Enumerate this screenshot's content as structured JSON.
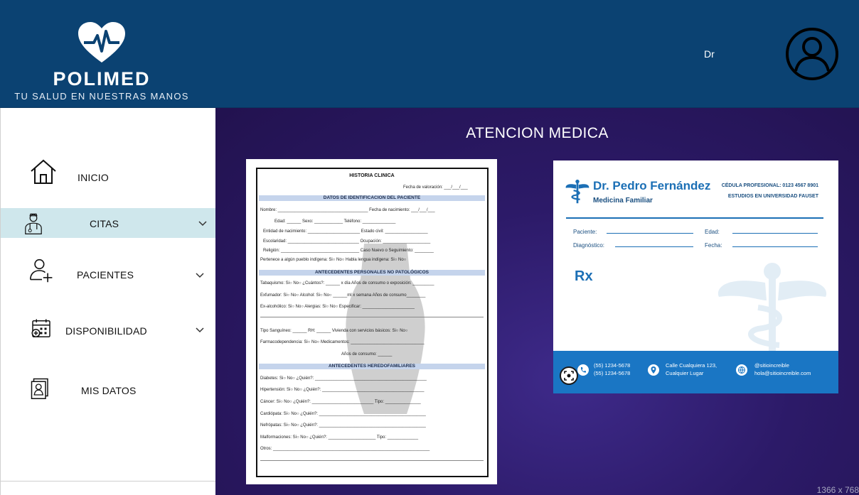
{
  "header": {
    "brand": "POLIMED",
    "tagline": "TU SALUD EN NUESTRAS MANOS",
    "user_label": "Dr"
  },
  "sidebar": {
    "items": [
      {
        "label": "INICIO",
        "icon": "home-icon"
      },
      {
        "label": "CITAS",
        "icon": "doctor-icon",
        "active": true,
        "expandable": true
      },
      {
        "label": "PACIENTES",
        "icon": "add-user-icon",
        "expandable": true
      },
      {
        "label": "DISPONIBILIDAD",
        "icon": "calendar-icon",
        "expandable": true
      },
      {
        "label": "MIS DATOS",
        "icon": "profile-document-icon"
      }
    ]
  },
  "main": {
    "title": "ATENCION MEDICA",
    "screen_size": "1366 x 768"
  },
  "historia_clinica": {
    "title": "HISTORIA CLINICA",
    "fecha_valoracion": "Fecha de valoración: ___/___/___",
    "section1": "DATOS DE IDENTIFICACION DEL PACIENTE",
    "section2": "ANTECEDENTES PERSONALES NO PATOLÓGICOS",
    "section3": "ANTECEDENTES HEREDOFAMILIARES",
    "rows1": [
      "Nombre: ______________________________________ Fecha de nacimiento: ___/___/___",
      "Edad: ______          Sexo: ____________          Teléfono: ______________",
      "Entidad de nacimiento: ______________________  Estado civil: __________________",
      "Escolaridad: ______________________________  Ocupación: ____________________",
      "Religión: _________________________________  Caso Nuevo o Seguimiento: ________",
      "Pertenece a algún pueblo indígena: Si○  No○     Habla lengua indígena: Si○  No○"
    ],
    "rows2": [
      "Tabaquismo: Si○  No○ ¿Cuántos?: ______ x día   Años de consumo o exposición: _________",
      "Exfumador: Si○ No○   Alcohol: Si○ No○ ______ml x semana   Años de consumo________",
      "Ex-alcohólico: Si○ No○   Alergias: Si○ No○ Especificar: ______________________",
      "Tipo Sanguíneo: ______   RH: ______   Vivienda con servicios básicos: Si○ No○",
      "Farmacodependencia: Si○ No○ Medicamentos: _______________________________",
      "Años de consumo: ______"
    ],
    "rows3": [
      "Diabetes: Si○ No○ ¿Quién?: _______________________________________________",
      "Hipertensión: Si○ No○ ¿Quién?: ___________________________________________",
      "Cáncer: Si○ No○ ¿Quién?: __________________________ Tipo: _______________",
      "Cardiópata: Si○ No○ ¿Quién?: _____________________________________________",
      "Nefrópatas: Si○ No○ ¿Quién?: _____________________________________________",
      "Malformaciones: Si○ No○ ¿Quién?: ____________________ Tipo: _____________",
      "Otros: __________________________________________________________________"
    ]
  },
  "receta": {
    "doctor_name": "Dr. Pedro Fernández",
    "specialty": "Medicina Familiar",
    "cedula": "CÉDULA PROFESIONAL: 0123 4567 8901",
    "universidad": "ESTUDIOS EN UNIVERSIDAD FAUSET",
    "paciente_label": "Paciente:",
    "edad_label": "Edad:",
    "diagnostico_label": "Diagnóstico:",
    "fecha_label": "Fecha:",
    "rx_symbol": "Rx",
    "phone1": "(55) 1234-5678",
    "phone2": "(55) 1234-5678",
    "address1": "Calle Cualquiera 123,",
    "address2": "Cualquier Lugar",
    "web": "@sitioincreible",
    "email": "hola@sitioincreible.com",
    "accent_color": "#1a76c4"
  }
}
